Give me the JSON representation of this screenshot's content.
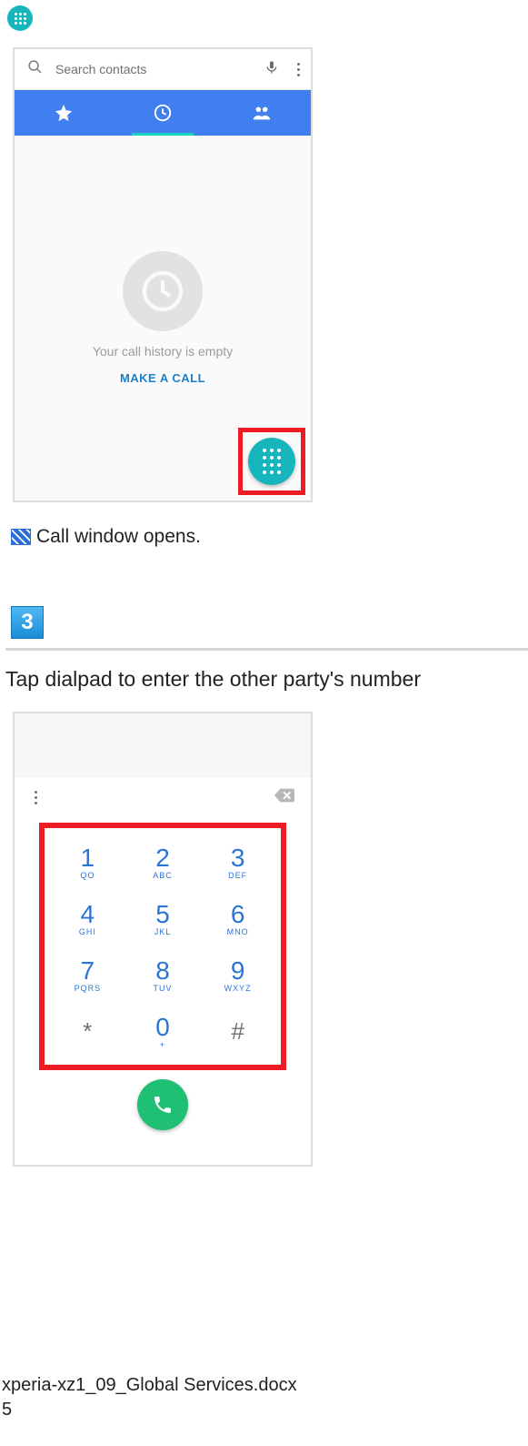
{
  "topIcon": "dialpad-icon",
  "callApp": {
    "searchPlaceholder": "Search contacts",
    "tabs": [
      "favorites",
      "recents",
      "contacts"
    ],
    "activeTab": 1,
    "emptyText": "Your call history is empty",
    "makeCallLabel": "MAKE A CALL"
  },
  "caption1": "Call window opens.",
  "step": {
    "number": "3",
    "text": "Tap dialpad to enter the other party's number"
  },
  "dialpad": {
    "keys": [
      {
        "digit": "1",
        "sub": "QO"
      },
      {
        "digit": "2",
        "sub": "ABC"
      },
      {
        "digit": "3",
        "sub": "DEF"
      },
      {
        "digit": "4",
        "sub": "GHI"
      },
      {
        "digit": "5",
        "sub": "JKL"
      },
      {
        "digit": "6",
        "sub": "MNO"
      },
      {
        "digit": "7",
        "sub": "PQRS"
      },
      {
        "digit": "8",
        "sub": "TUV"
      },
      {
        "digit": "9",
        "sub": "WXYZ"
      },
      {
        "digit": "*",
        "sub": ""
      },
      {
        "digit": "0",
        "sub": "+"
      },
      {
        "digit": "#",
        "sub": ""
      }
    ]
  },
  "footer": {
    "filename": "xperia-xz1_09_Global Services.docx",
    "page": "5"
  }
}
